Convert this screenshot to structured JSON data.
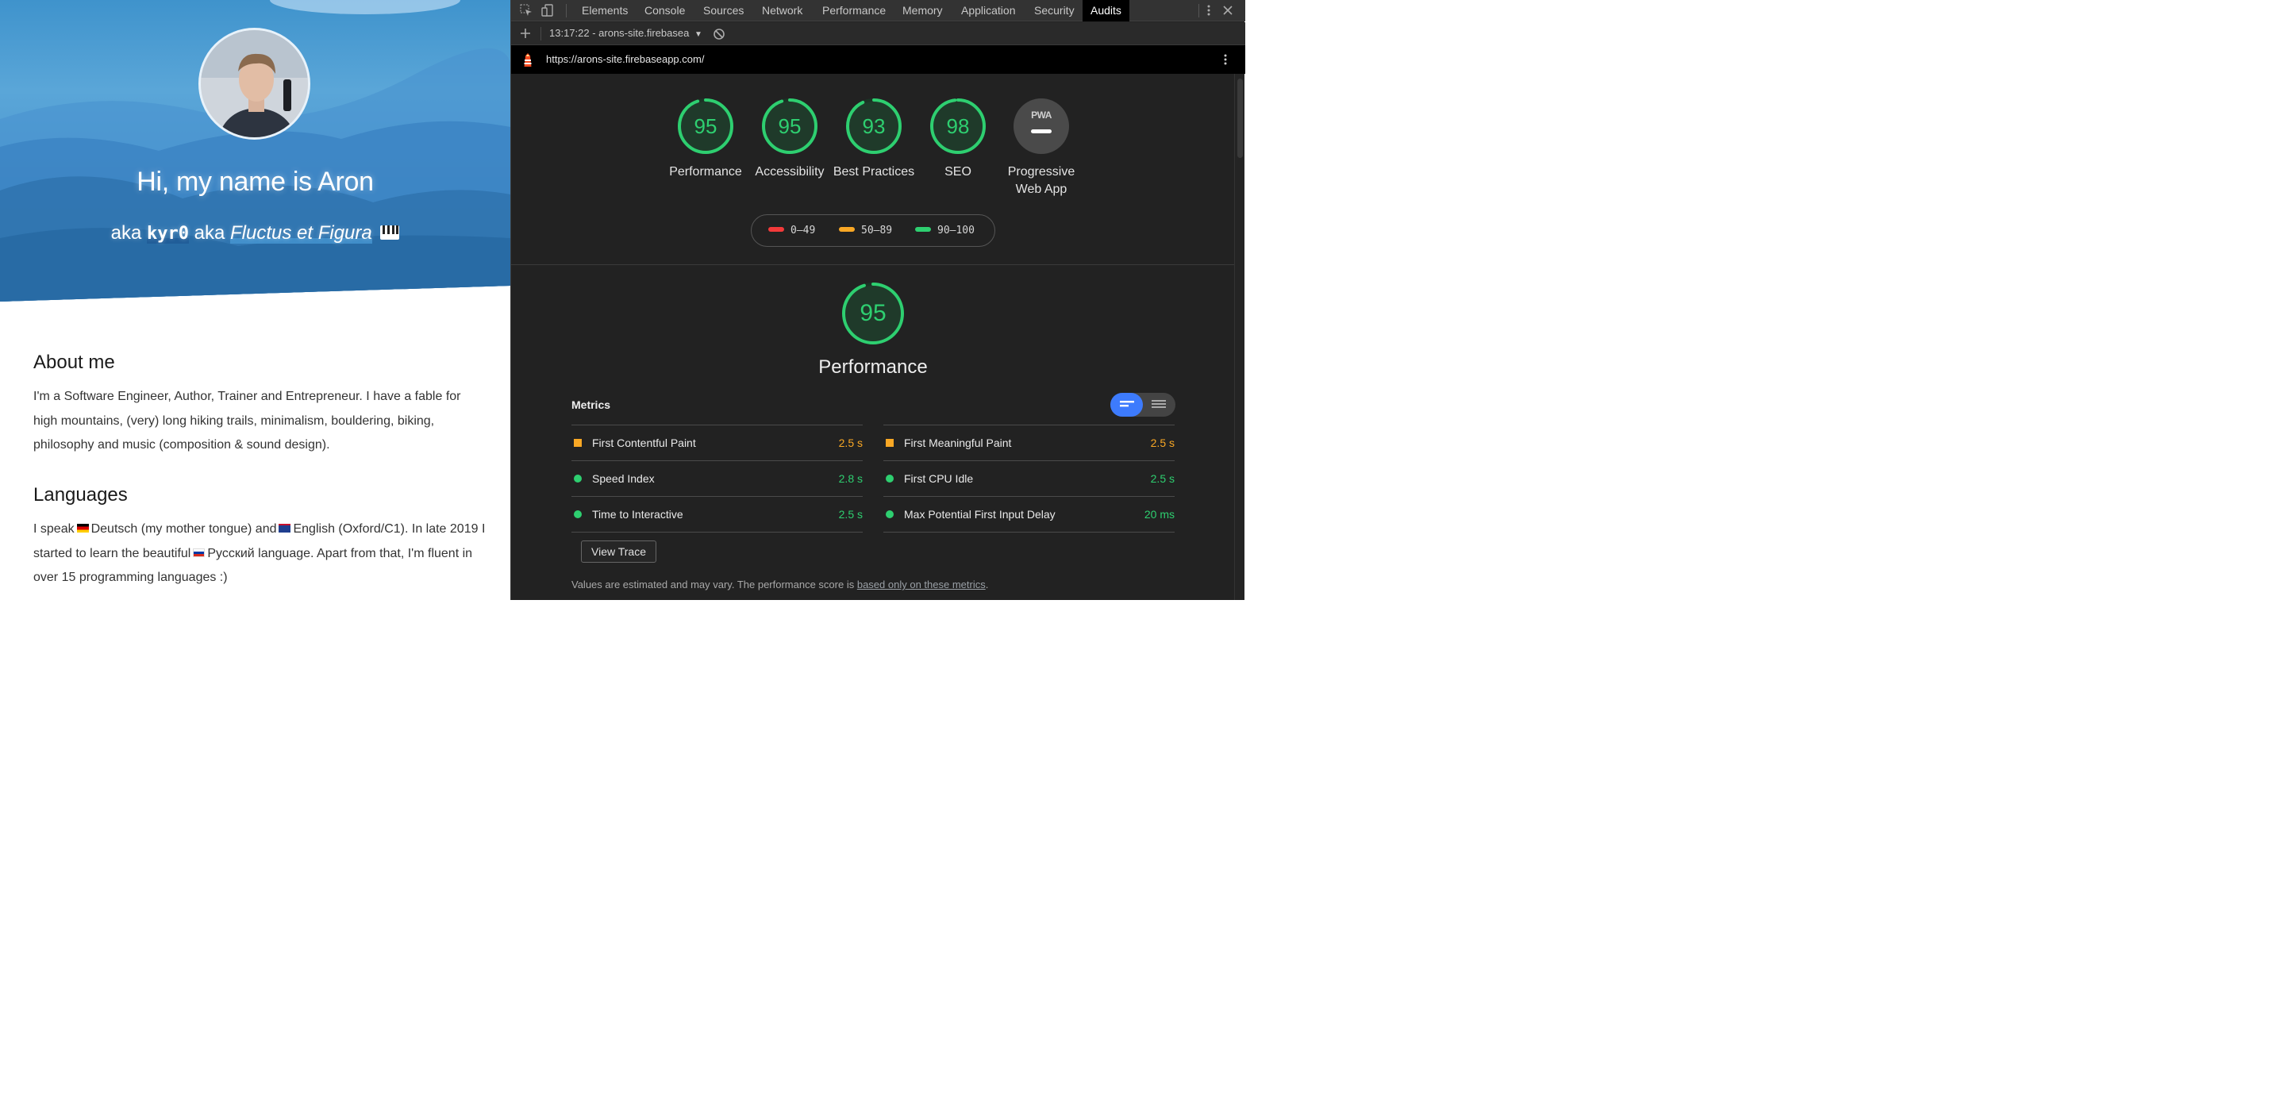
{
  "site": {
    "hero": {
      "title": "Hi, my name is Aron",
      "sub_aka1": "aka",
      "sub_handle": "kyr0",
      "sub_aka2": "aka",
      "sub_italic": "Fluctus et Figura"
    },
    "about": {
      "heading": "About me",
      "text": "I'm a Software Engineer, Author, Trainer and Entrepreneur. I have a fable for high mountains, (very) long hiking trails, minimalism, bouldering, biking, philosophy and music (composition & sound design)."
    },
    "languages": {
      "heading": "Languages",
      "t1": "I speak",
      "t2": "Deutsch (my mother tongue) and",
      "t3": "English (Oxford/C1). In late 2019 I started to learn the beautiful",
      "t4": "Русский language. Apart from that, I'm fluent in over 15 programming languages :)"
    }
  },
  "devtools": {
    "tabs": [
      "Elements",
      "Console",
      "Sources",
      "Network",
      "Performance",
      "Memory",
      "Application",
      "Security",
      "Audits"
    ],
    "active_tab": "Audits",
    "report_select": "13:17:22 - arons-site.firebasea",
    "url": "https://arons-site.firebaseapp.com/",
    "gauges": [
      {
        "score": "95",
        "label": "Performance"
      },
      {
        "score": "95",
        "label": "Accessibility"
      },
      {
        "score": "93",
        "label": "Best Practices"
      },
      {
        "score": "98",
        "label": "SEO"
      }
    ],
    "pwa": {
      "badge": "PWA",
      "label": "Progressive Web App"
    },
    "legend": [
      {
        "range": "0–49",
        "color": "#f33a3a"
      },
      {
        "range": "50–89",
        "color": "#f9a825"
      },
      {
        "range": "90–100",
        "color": "#2ecf70"
      }
    ],
    "performance": {
      "score": "95",
      "title": "Performance",
      "metrics_heading": "Metrics",
      "metrics_left": [
        {
          "name": "First Contentful Paint",
          "value": "2.5 s",
          "status": "average"
        },
        {
          "name": "Speed Index",
          "value": "2.8 s",
          "status": "pass"
        },
        {
          "name": "Time to Interactive",
          "value": "2.5 s",
          "status": "pass"
        }
      ],
      "metrics_right": [
        {
          "name": "First Meaningful Paint",
          "value": "2.5 s",
          "status": "average"
        },
        {
          "name": "First CPU Idle",
          "value": "2.5 s",
          "status": "pass"
        },
        {
          "name": "Max Potential First Input Delay",
          "value": "20 ms",
          "status": "pass"
        }
      ],
      "view_trace": "View Trace",
      "footnote_text": "Values are estimated and may vary. The performance score is ",
      "footnote_link": "based only on these metrics",
      "footnote_end": "."
    },
    "colors": {
      "pass": "#2ecf70",
      "average": "#f9a825",
      "fail": "#f33a3a",
      "accent": "#3d7bfd"
    }
  }
}
